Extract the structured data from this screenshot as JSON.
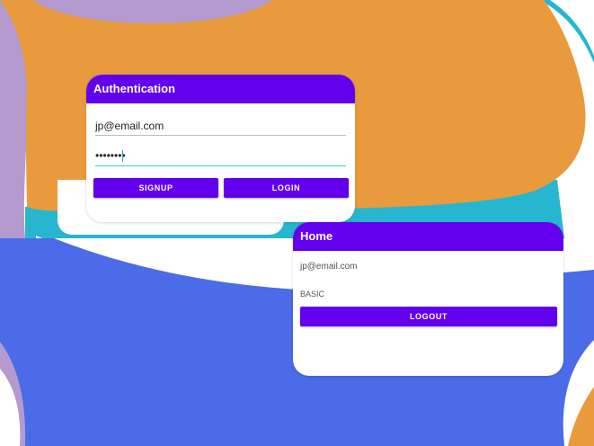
{
  "auth": {
    "title": "Authentication",
    "email_value": "jp@email.com",
    "password_value": "••••••••",
    "signup_label": "SIGNUP",
    "login_label": "LOGIN"
  },
  "home": {
    "title": "Home",
    "email": "jp@email.com",
    "role": "BASIC",
    "logout_label": "LOGOUT"
  },
  "colors": {
    "primary": "#6200ee",
    "background_blue": "#4b6be8",
    "background_orange": "#e89a3c",
    "background_purple": "#b59ad0",
    "background_teal": "#26b6cf"
  }
}
